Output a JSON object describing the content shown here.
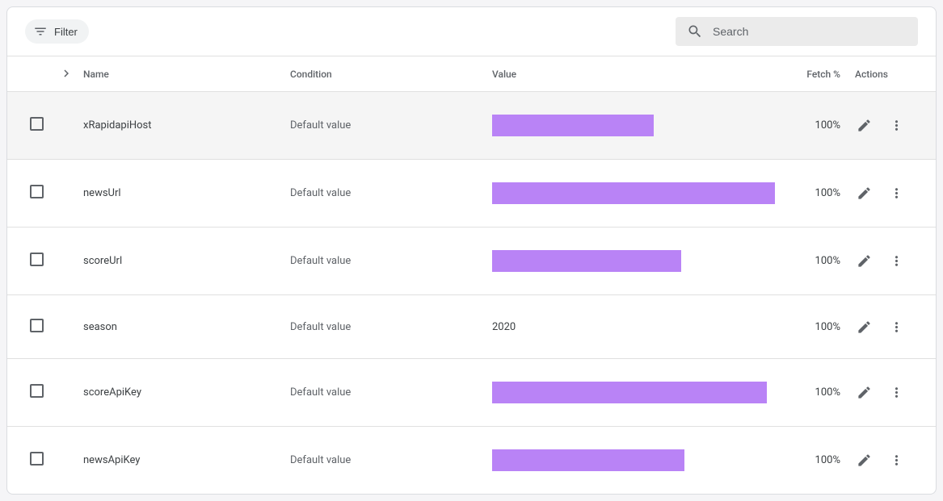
{
  "toolbar": {
    "filter_label": "Filter",
    "search_placeholder": "Search"
  },
  "table": {
    "headers": {
      "name": "Name",
      "condition": "Condition",
      "value": "Value",
      "fetch": "Fetch %",
      "actions": "Actions"
    },
    "rows": [
      {
        "name": "xRapidapiHost",
        "condition": "Default value",
        "value_redacted": true,
        "redact_width": 200,
        "value": "",
        "fetch": "100%",
        "hovered": true
      },
      {
        "name": "newsUrl",
        "condition": "Default value",
        "value_redacted": true,
        "redact_width": 350,
        "value": "",
        "fetch": "100%",
        "hovered": false
      },
      {
        "name": "scoreUrl",
        "condition": "Default value",
        "value_redacted": true,
        "redact_width": 234,
        "value": "",
        "fetch": "100%",
        "hovered": false
      },
      {
        "name": "season",
        "condition": "Default value",
        "value_redacted": false,
        "redact_width": 0,
        "value": "2020",
        "fetch": "100%",
        "hovered": false
      },
      {
        "name": "scoreApiKey",
        "condition": "Default value",
        "value_redacted": true,
        "redact_width": 340,
        "value": "",
        "fetch": "100%",
        "hovered": false
      },
      {
        "name": "newsApiKey",
        "condition": "Default value",
        "value_redacted": true,
        "redact_width": 238,
        "value": "",
        "fetch": "100%",
        "hovered": false
      }
    ]
  }
}
